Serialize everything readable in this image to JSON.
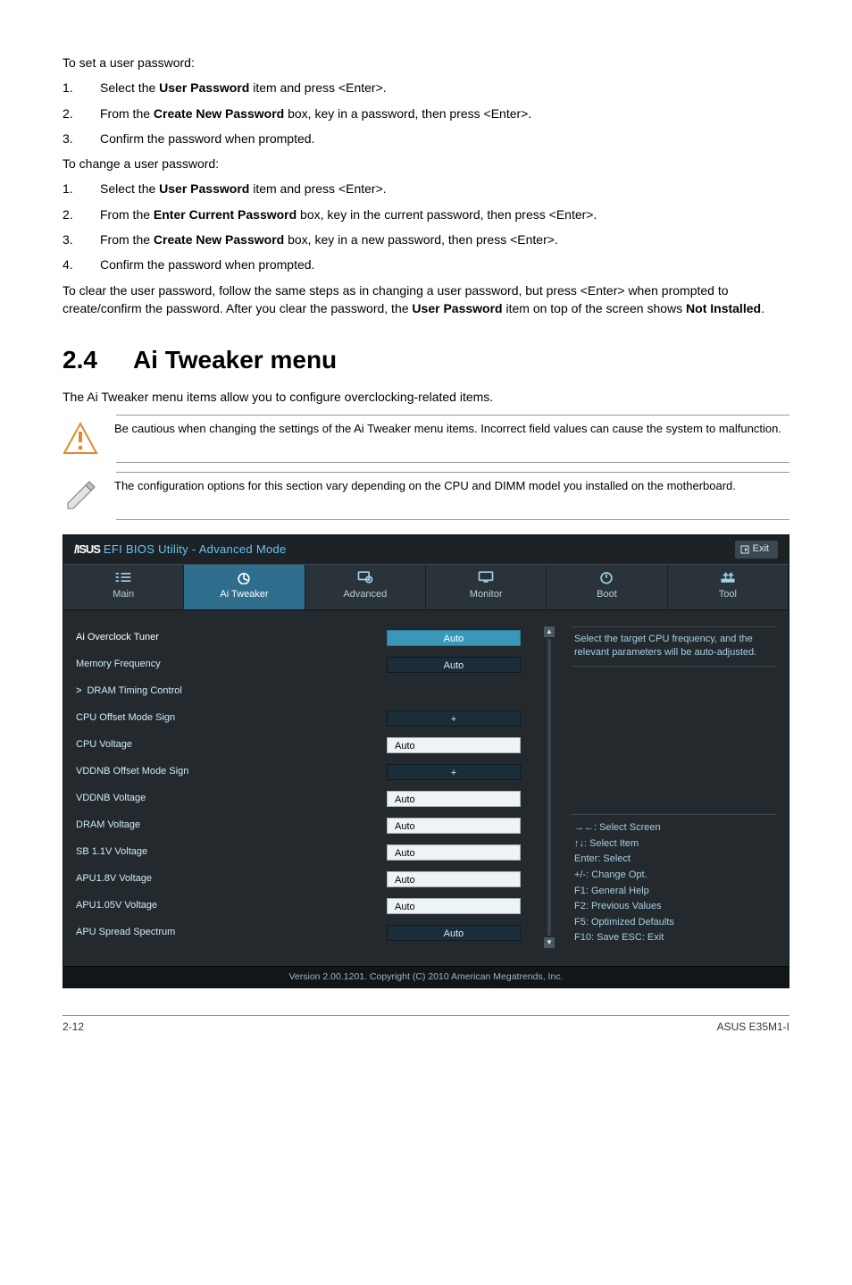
{
  "intro1": "To set a user password:",
  "steps_set": [
    {
      "n": "1.",
      "pre": "Select the ",
      "b": "User Password",
      "post": " item and press <Enter>."
    },
    {
      "n": "2.",
      "pre": "From the ",
      "b": "Create New Password",
      "post": " box, key in a password, then press <Enter>."
    },
    {
      "n": "3.",
      "pre": "Confirm the password when prompted.",
      "b": "",
      "post": ""
    }
  ],
  "intro2": "To change a user password:",
  "steps_change": [
    {
      "n": "1.",
      "pre": "Select the ",
      "b": "User Password",
      "post": " item and press <Enter>."
    },
    {
      "n": "2.",
      "pre": "From the ",
      "b": "Enter Current Password",
      "post": " box, key in the current password, then press <Enter>."
    },
    {
      "n": "3.",
      "pre": "From the ",
      "b": "Create New Password",
      "post": " box, key in a new password, then press <Enter>."
    },
    {
      "n": "4.",
      "pre": "Confirm the password when prompted.",
      "b": "",
      "post": ""
    }
  ],
  "clear": {
    "p1": "To clear the user password, follow the same steps as in changing a user password, but press <Enter> when prompted to create/confirm the password. After you clear the password, the ",
    "b1": "User Password",
    "p2": " item on top of the screen shows ",
    "b2": "Not Installed",
    "p3": "."
  },
  "section": {
    "num": "2.4",
    "title": "Ai Tweaker menu"
  },
  "section_sub": "The Ai Tweaker menu items allow you to configure overclocking-related items.",
  "note1": "Be cautious when changing the settings of the Ai Tweaker menu items. Incorrect field values can cause the system to malfunction.",
  "note2": "The configuration options for this section vary depending on the CPU and DIMM model you installed on the motherboard.",
  "bios": {
    "brand": "/ISUS",
    "title": " EFI BIOS Utility - Advanced Mode",
    "exit": "Exit",
    "tabs": [
      "Main",
      "Ai  Tweaker",
      "Advanced",
      "Monitor",
      "Boot",
      "Tool"
    ],
    "rows": [
      {
        "label": "Ai Overclock Tuner",
        "val": "Auto",
        "kind": "sel"
      },
      {
        "label": "Memory Frequency",
        "val": "Auto",
        "kind": "dark"
      },
      {
        "label": "DRAM Timing Control",
        "val": "",
        "kind": "link"
      },
      {
        "label": "CPU Offset Mode Sign",
        "val": "+",
        "kind": "plus"
      },
      {
        "label": "CPU Voltage",
        "val": "Auto",
        "kind": "input"
      },
      {
        "label": "VDDNB Offset Mode Sign",
        "val": "+",
        "kind": "plus"
      },
      {
        "label": "VDDNB Voltage",
        "val": "Auto",
        "kind": "input"
      },
      {
        "label": "DRAM Voltage",
        "val": "Auto",
        "kind": "input"
      },
      {
        "label": "SB 1.1V Voltage",
        "val": "Auto",
        "kind": "input"
      },
      {
        "label": "APU1.8V Voltage",
        "val": "Auto",
        "kind": "input"
      },
      {
        "label": "APU1.05V Voltage",
        "val": "Auto",
        "kind": "input"
      },
      {
        "label": "APU Spread Spectrum",
        "val": "Auto",
        "kind": "dark"
      }
    ],
    "help": "Select the target CPU frequency, and the relevant parameters will be auto-adjusted.",
    "keys": [
      "→←:  Select Screen",
      "↑↓:  Select Item",
      "Enter:  Select",
      "+/-:  Change Opt.",
      "F1:  General Help",
      "F2:  Previous Values",
      "F5:  Optimized Defaults",
      "F10:  Save   ESC:  Exit"
    ],
    "footer": "Version  2.00.1201.   Copyright  (C)  2010  American  Megatrends,  Inc."
  },
  "page_footer": {
    "left": "2-12",
    "right": "ASUS E35M1-I"
  }
}
